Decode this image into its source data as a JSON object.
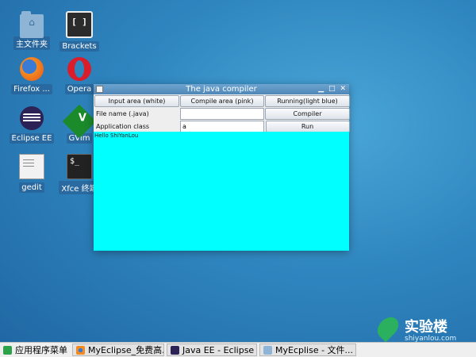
{
  "desktop": {
    "icons": [
      {
        "label": "主文件夹",
        "icon": "home-folder-icon"
      },
      {
        "label": "Brackets",
        "icon": "brackets-icon"
      },
      {
        "label": "Firefox ...",
        "icon": "firefox-icon"
      },
      {
        "label": "Opera",
        "icon": "opera-icon"
      },
      {
        "label": "Eclipse EE",
        "icon": "eclipse-icon"
      },
      {
        "label": "GVim",
        "icon": "gvim-icon"
      },
      {
        "label": "gedit",
        "icon": "gedit-icon"
      },
      {
        "label": "Xfce 终端",
        "icon": "terminal-icon"
      }
    ]
  },
  "window": {
    "title": "The java compiler",
    "buttons": {
      "input_area": "Input area (white)",
      "compile_area": "Compile area (pink)",
      "running_area": "Running(light blue)",
      "compiler": "Compiler",
      "run": "Run"
    },
    "labels": {
      "file_name": "File name (.java)",
      "application_class": "Application class"
    },
    "fields": {
      "file_name_value": "",
      "application_class_value": "a"
    },
    "output_text": "Hello ShiYanLou",
    "output_color": "#00ffff"
  },
  "watermark": {
    "brand": "实验楼",
    "domain": "shiyanlou.com"
  },
  "taskbar": {
    "menu_label": "应用程序菜单",
    "tasks": [
      {
        "label": "MyEclipse_免费高..."
      },
      {
        "label": "Java EE - Eclipse"
      },
      {
        "label": "MyEcplise - 文件..."
      }
    ]
  }
}
